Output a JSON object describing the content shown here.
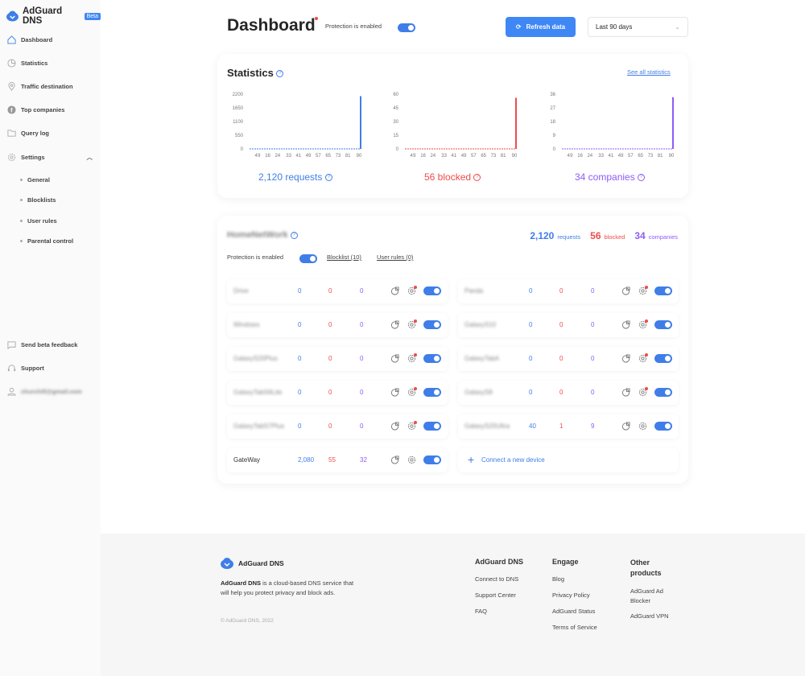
{
  "sidebar": {
    "brand": "AdGuard DNS",
    "badge": "Beta",
    "items": [
      {
        "label": "Dashboard"
      },
      {
        "label": "Statistics"
      },
      {
        "label": "Traffic destination"
      },
      {
        "label": "Top companies"
      },
      {
        "label": "Query log"
      },
      {
        "label": "Settings"
      }
    ],
    "sub_items": [
      {
        "label": "General"
      },
      {
        "label": "Blocklists"
      },
      {
        "label": "User rules"
      },
      {
        "label": "Parental control"
      }
    ],
    "bottom": [
      {
        "label": "Send beta feedback"
      },
      {
        "label": "Support"
      },
      {
        "label": "churchill@gmail.com"
      }
    ]
  },
  "header": {
    "title": "Dashboard",
    "protection": "Protection is enabled",
    "refresh": "Refresh data",
    "period": "Last 90 days"
  },
  "statistics": {
    "title": "Statistics",
    "see_all": "See all statistics",
    "summaries": [
      {
        "label": "2,120 requests"
      },
      {
        "label": "56 blocked"
      },
      {
        "label": "34 companies"
      }
    ]
  },
  "chart_data": [
    {
      "type": "bar",
      "name": "requests",
      "color": "#3f7ee8",
      "yticks": [
        "2200",
        "1650",
        "1100",
        "550",
        "0"
      ],
      "ylim": [
        0,
        2200
      ],
      "xticks": [
        "4",
        "9",
        "16",
        "24",
        "33",
        "41",
        "49",
        "57",
        "65",
        "73",
        "81",
        "90"
      ],
      "x": [
        90
      ],
      "values": [
        2120
      ]
    },
    {
      "type": "bar",
      "name": "blocked",
      "color": "#f04b4b",
      "yticks": [
        "60",
        "45",
        "30",
        "15",
        "0"
      ],
      "ylim": [
        0,
        60
      ],
      "xticks": [
        "4",
        "9",
        "16",
        "24",
        "33",
        "41",
        "49",
        "57",
        "65",
        "73",
        "81",
        "90"
      ],
      "x": [
        90
      ],
      "values": [
        56
      ]
    },
    {
      "type": "bar",
      "name": "companies",
      "color": "#8d5cf6",
      "yticks": [
        "36",
        "27",
        "18",
        "9",
        "0"
      ],
      "ylim": [
        0,
        36
      ],
      "xticks": [
        "4",
        "9",
        "16",
        "24",
        "33",
        "41",
        "49",
        "57",
        "65",
        "73",
        "81",
        "90"
      ],
      "x": [
        90
      ],
      "values": [
        34
      ]
    }
  ],
  "network": {
    "name": "HomeNetWork",
    "requests": "2,120",
    "requests_label": "requests",
    "blocked": "56",
    "blocked_label": "blocked",
    "companies": "34",
    "companies_label": "companies",
    "protection": "Protection is enabled",
    "blocklist": "Blocklist (10)",
    "user_rules": "User rules (0)",
    "connect": "Connect a new device",
    "devices": [
      {
        "name": "Drive",
        "r": "0",
        "b": "0",
        "c": "0"
      },
      {
        "name": "Panda",
        "r": "0",
        "b": "0",
        "c": "0"
      },
      {
        "name": "Windows",
        "r": "0",
        "b": "0",
        "c": "0"
      },
      {
        "name": "GalaxyS10",
        "r": "0",
        "b": "0",
        "c": "0"
      },
      {
        "name": "GalaxyS20Plus",
        "r": "0",
        "b": "0",
        "c": "0"
      },
      {
        "name": "GalaxyTabA",
        "r": "0",
        "b": "0",
        "c": "0"
      },
      {
        "name": "GalaxyTabS6Lite",
        "r": "0",
        "b": "0",
        "c": "0"
      },
      {
        "name": "GalaxyS8",
        "r": "0",
        "b": "0",
        "c": "0"
      },
      {
        "name": "GalaxyTabS7Plus",
        "r": "0",
        "b": "0",
        "c": "0"
      },
      {
        "name": "GalaxyS20Ultra",
        "r": "40",
        "b": "1",
        "c": "9"
      },
      {
        "name": "GateWay",
        "r": "2,080",
        "b": "55",
        "c": "32"
      }
    ]
  },
  "footer": {
    "brand": "AdGuard DNS",
    "desc_bold": "AdGuard DNS",
    "desc": " is a cloud-based DNS service that will help you protect privacy and block ads.",
    "copyright": "© AdGuard DNS, 2022",
    "cols": [
      {
        "title": "AdGuard DNS",
        "links": [
          "Connect to DNS",
          "Support Center",
          "FAQ"
        ]
      },
      {
        "title": "Engage",
        "links": [
          "Blog",
          "Privacy Policy",
          "AdGuard Status",
          "Terms of Service"
        ]
      },
      {
        "title": "Other products",
        "links": [
          "AdGuard Ad Blocker",
          "AdGuard VPN"
        ]
      }
    ]
  }
}
